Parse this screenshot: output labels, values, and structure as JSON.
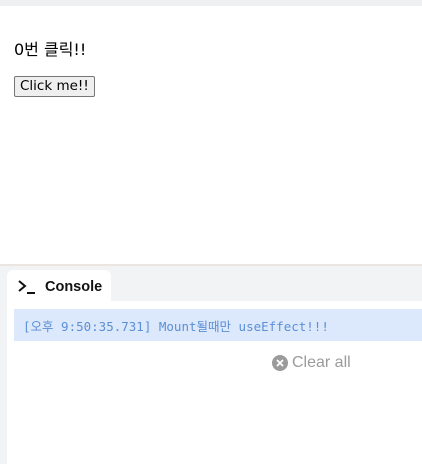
{
  "preview": {
    "count_text": "0번 클릭!!",
    "button_label": "Click me!!"
  },
  "console": {
    "tab_label": "Console",
    "tab_icon": "terminal-prompt-icon",
    "log_entries": [
      {
        "timestamp": "[오후 9:50:35.731]",
        "message": "Mount될때만 useEffect!!!",
        "full_text": "[오후 9:50:35.731] Mount될때만 useEffect!!!"
      }
    ],
    "clear_label": "Clear all",
    "clear_icon": "close-circle-icon"
  },
  "colors": {
    "log_highlight": "#dce8fb",
    "log_text": "#5b8fd6",
    "muted_text": "#9b9b9b"
  }
}
